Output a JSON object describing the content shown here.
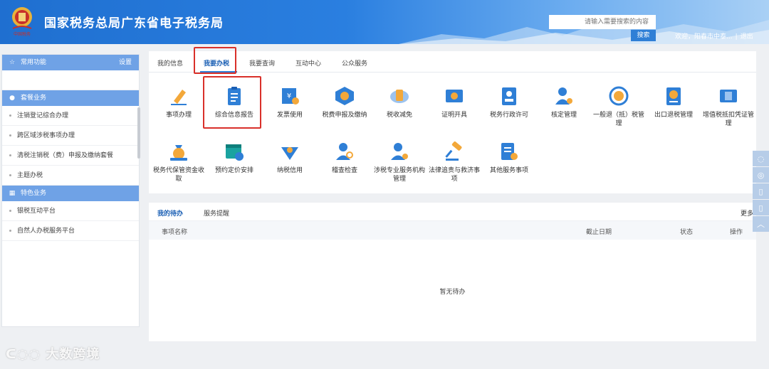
{
  "header": {
    "site_title": "国家税务总局广东省电子税务局",
    "emblem_text": "中国税务",
    "search_placeholder": "请输入需要搜索的内容",
    "search_button": "搜索",
    "welcome": "欢迎，阳春市中泰...",
    "separator": "|",
    "logout": "退出",
    "colors": {
      "primary": "#2a7fe0",
      "accent_red": "#d9302a"
    }
  },
  "sidebar": {
    "common": {
      "label": "常用功能",
      "settings": "设置",
      "icon": "star-icon"
    },
    "package": {
      "label": "套餐业务",
      "icon": "package-icon"
    },
    "package_items": [
      "注销登记综合办理",
      "跨区域涉税事项办理",
      "清税注销税（费）申报及缴纳套餐",
      "主题办税"
    ],
    "special": {
      "label": "特色业务",
      "icon": "grid-icon"
    },
    "special_items": [
      "银税互动平台",
      "自然人办税服务平台"
    ]
  },
  "tabs": [
    "我的信息",
    "我要办税",
    "我要查询",
    "互动中心",
    "公众服务"
  ],
  "services_row1": [
    {
      "label": "事项办理",
      "icon": "pen-icon"
    },
    {
      "label": "综合信息报告",
      "icon": "report-icon"
    },
    {
      "label": "发票使用",
      "icon": "invoice-icon"
    },
    {
      "label": "税费申报及缴纳",
      "icon": "declare-icon"
    },
    {
      "label": "税收减免",
      "icon": "tax-relief-icon"
    },
    {
      "label": "证明开具",
      "icon": "certificate-icon"
    },
    {
      "label": "税务行政许可",
      "icon": "license-icon"
    },
    {
      "label": "核定管理",
      "icon": "assessment-icon"
    },
    {
      "label": "一般退（抵）税管理",
      "icon": "refund-icon"
    },
    {
      "label": "出口退税管理",
      "icon": "export-refund-icon"
    },
    {
      "label": "增值税抵扣凭证管理",
      "icon": "vat-deduct-icon"
    }
  ],
  "services_row2": [
    {
      "label": "税务代保管资金收取",
      "icon": "money-bag-icon"
    },
    {
      "label": "预约定价安排",
      "icon": "calendar-icon"
    },
    {
      "label": "纳税信用",
      "icon": "credit-icon"
    },
    {
      "label": "稽查检查",
      "icon": "inspect-icon"
    },
    {
      "label": "涉税专业服务机构管理",
      "icon": "agency-icon"
    },
    {
      "label": "法律追责与救济事项",
      "icon": "gavel-icon"
    },
    {
      "label": "其他服务事项",
      "icon": "other-service-icon"
    }
  ],
  "todo": {
    "tabs": [
      "我的待办",
      "服务提醒"
    ],
    "more": "更多",
    "columns": [
      "事项名称",
      "截止日期",
      "状态",
      "操作"
    ],
    "empty": "暂无待办"
  },
  "watermark": "大数跨境"
}
